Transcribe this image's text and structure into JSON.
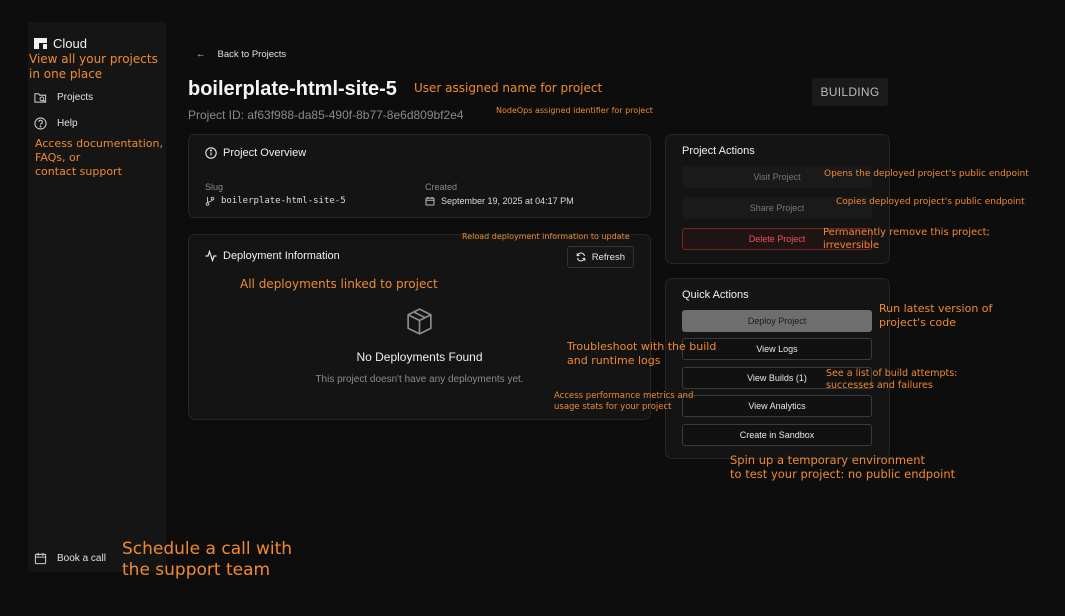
{
  "sidebar": {
    "brand": "Cloud",
    "items": [
      {
        "label": "Projects",
        "icon": "folder-search-icon"
      },
      {
        "label": "Help",
        "icon": "help-circle-icon"
      }
    ],
    "book_call": "Book a call"
  },
  "header": {
    "back_label": "Back to Projects",
    "title": "boilerplate-html-site-5",
    "project_id": "Project ID: af63f988-da85-490f-8b77-8e6d809bf2e4",
    "status": "BUILDING"
  },
  "overview": {
    "title": "Project Overview",
    "slug_label": "Slug",
    "slug_value": "boilerplate-html-site-5",
    "created_label": "Created",
    "created_value": "September 19, 2025 at 04:17 PM"
  },
  "deployment": {
    "title": "Deployment Information",
    "refresh_label": "Refresh",
    "empty_title": "No Deployments Found",
    "empty_text": "This project doesn't have any deployments yet."
  },
  "project_actions": {
    "title": "Project Actions",
    "visit": "Visit Project",
    "share": "Share Project",
    "delete": "Delete Project"
  },
  "quick_actions": {
    "title": "Quick Actions",
    "deploy": "Deploy Project",
    "logs": "View Logs",
    "builds": "View Builds (1)",
    "analytics": "View Analytics",
    "sandbox": "Create in Sandbox"
  },
  "annotations": {
    "view_projects": "View all your projects\nin one place",
    "help": "Access documentation,\nFAQs, or\ncontact support",
    "book_call": "Schedule a call with\nthe support team",
    "title": "User assigned name for project",
    "project_id": "NodeOps assigned identifier for project",
    "reload": "Reload deployment information to update",
    "deployments": "All deployments linked to project",
    "visit": "Opens the deployed project's public endpoint",
    "share": "Copies deployed project's public endpoint",
    "delete": "Permanently remove this project;\nirreversible",
    "deploy": "Run latest version of\nproject's code",
    "logs": "Troubleshoot with the build\nand runtime logs",
    "builds": "See a list of build attempts:\nsuccesses and failures",
    "analytics": "Access performance metrics and\nusage stats for your project",
    "sandbox": "Spin up a temporary environment\nto test your project: no public endpoint"
  },
  "colors": {
    "background": "#0d0d0d",
    "panel": "#141414",
    "annotation": "#f08a32",
    "danger": "#ee5555"
  }
}
